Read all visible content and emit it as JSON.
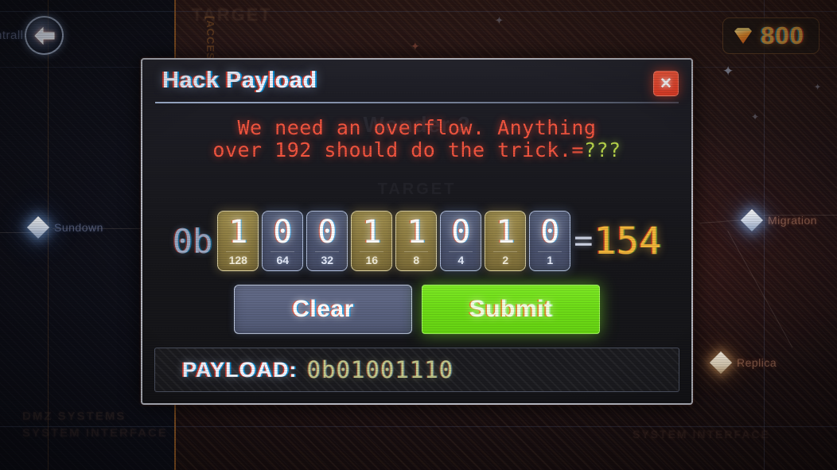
{
  "hud": {
    "back_button_icon": "arrow-left-icon",
    "currency": {
      "icon": "gem-icon",
      "amount": "800",
      "color": "#d79b3e"
    }
  },
  "background": {
    "nodes": [
      {
        "label": "Sundown",
        "style": "cool"
      },
      {
        "label": "Migration",
        "style": "warm"
      },
      {
        "label": "Replica",
        "style": "warm"
      },
      {
        "label": "ntrall",
        "style": "cool"
      }
    ],
    "ghost_texts": [
      "Wonder 2",
      "TARGET",
      "DMZ SYSTEMS",
      "SYSTEM INTERFACE",
      "[ACCESS]"
    ]
  },
  "dialog": {
    "title": "Hack Payload",
    "close_label": "✕",
    "close_icon": "close-icon",
    "prompt_line_1": "We need an overflow. Anything",
    "prompt_line_2": "over 192 should do the trick.",
    "target_equals": "=",
    "target_value": "???",
    "prefix": "0b",
    "equals": "=",
    "decimal_value": "154",
    "bits": [
      {
        "value": "1",
        "weight": "128",
        "state": "on"
      },
      {
        "value": "0",
        "weight": "64",
        "state": "off"
      },
      {
        "value": "0",
        "weight": "32",
        "state": "off"
      },
      {
        "value": "1",
        "weight": "16",
        "state": "on"
      },
      {
        "value": "1",
        "weight": "8",
        "state": "on"
      },
      {
        "value": "0",
        "weight": "4",
        "state": "off"
      },
      {
        "value": "1",
        "weight": "2",
        "state": "on"
      },
      {
        "value": "0",
        "weight": "1",
        "state": "off"
      }
    ],
    "clear_label": "Clear",
    "submit_label": "Submit",
    "payload_label": "PAYLOAD:",
    "payload_value": "0b01001110"
  }
}
